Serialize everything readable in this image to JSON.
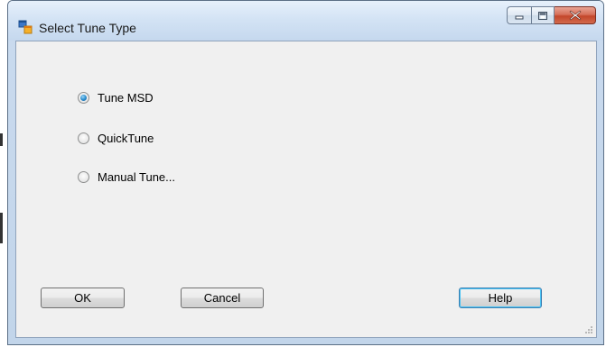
{
  "window": {
    "title": "Select Tune Type",
    "controls": {
      "minimize_icon": "minimize-icon",
      "maximize_icon": "maximize-icon",
      "close_icon": "close-icon"
    }
  },
  "options": [
    {
      "label": "Tune MSD",
      "checked": true
    },
    {
      "label": "QuickTune",
      "checked": false
    },
    {
      "label": "Manual Tune...",
      "checked": false
    }
  ],
  "buttons": {
    "ok": "OK",
    "cancel": "Cancel",
    "help": "Help"
  },
  "colors": {
    "titlebar": "#c9daee",
    "client": "#f0f0f0",
    "close_button": "#c3462a",
    "radio_selected": "#2c8fd0"
  }
}
